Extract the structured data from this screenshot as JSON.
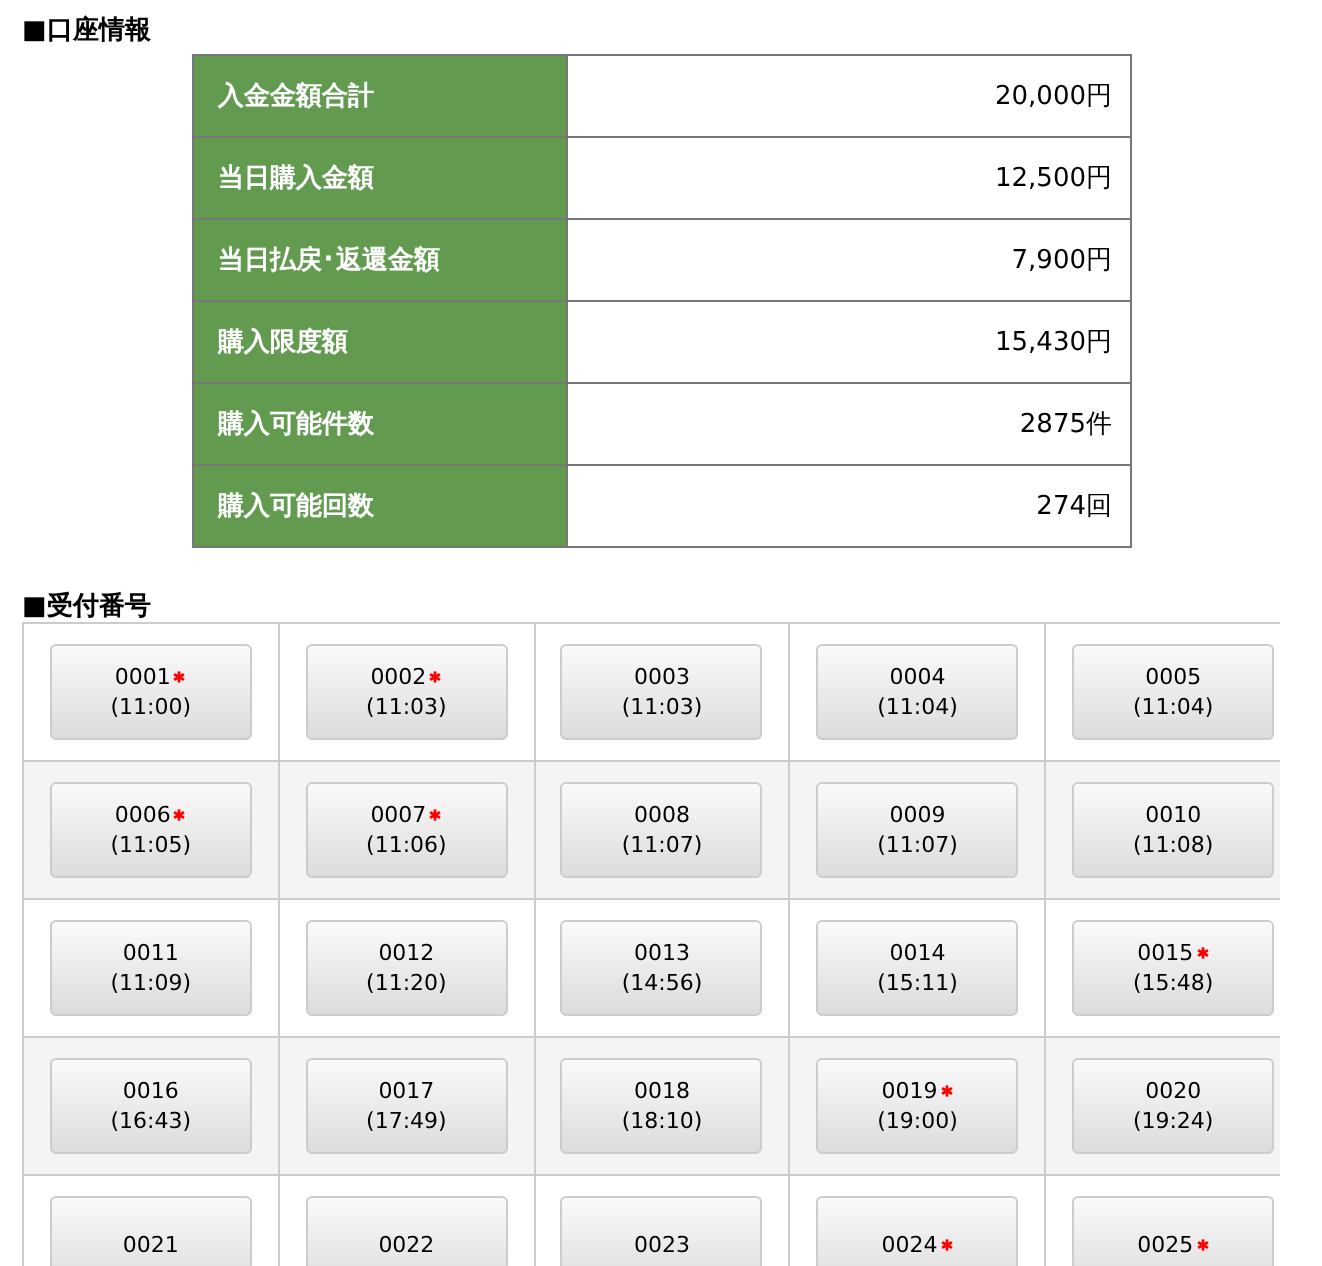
{
  "account": {
    "heading": "■口座情報",
    "rows": [
      {
        "label": "入金金額合計",
        "value": "20,000円"
      },
      {
        "label": "当日購入金額",
        "value": "12,500円"
      },
      {
        "label": "当日払戻･返還金額",
        "value": "7,900円"
      },
      {
        "label": "購入限度額",
        "value": "15,430円"
      },
      {
        "label": "購入可能件数",
        "value": "2875件"
      },
      {
        "label": "購入可能回数",
        "value": "274回"
      }
    ]
  },
  "receipts": {
    "heading": "■受付番号",
    "items": [
      {
        "number": "0001",
        "time": "(11:00)",
        "marked": true
      },
      {
        "number": "0002",
        "time": "(11:03)",
        "marked": true
      },
      {
        "number": "0003",
        "time": "(11:03)",
        "marked": false
      },
      {
        "number": "0004",
        "time": "(11:04)",
        "marked": false
      },
      {
        "number": "0005",
        "time": "(11:04)",
        "marked": false
      },
      {
        "number": "0006",
        "time": "(11:05)",
        "marked": true
      },
      {
        "number": "0007",
        "time": "(11:06)",
        "marked": true
      },
      {
        "number": "0008",
        "time": "(11:07)",
        "marked": false
      },
      {
        "number": "0009",
        "time": "(11:07)",
        "marked": false
      },
      {
        "number": "0010",
        "time": "(11:08)",
        "marked": false
      },
      {
        "number": "0011",
        "time": "(11:09)",
        "marked": false
      },
      {
        "number": "0012",
        "time": "(11:20)",
        "marked": false
      },
      {
        "number": "0013",
        "time": "(14:56)",
        "marked": false
      },
      {
        "number": "0014",
        "time": "(15:11)",
        "marked": false
      },
      {
        "number": "0015",
        "time": "(15:48)",
        "marked": true
      },
      {
        "number": "0016",
        "time": "(16:43)",
        "marked": false
      },
      {
        "number": "0017",
        "time": "(17:49)",
        "marked": false
      },
      {
        "number": "0018",
        "time": "(18:10)",
        "marked": false
      },
      {
        "number": "0019",
        "time": "(19:00)",
        "marked": true
      },
      {
        "number": "0020",
        "time": "(19:24)",
        "marked": false
      },
      {
        "number": "0021",
        "marked": false
      },
      {
        "number": "0022",
        "marked": false
      },
      {
        "number": "0023",
        "marked": false
      },
      {
        "number": "0024",
        "marked": true
      },
      {
        "number": "0025",
        "marked": true
      }
    ]
  }
}
